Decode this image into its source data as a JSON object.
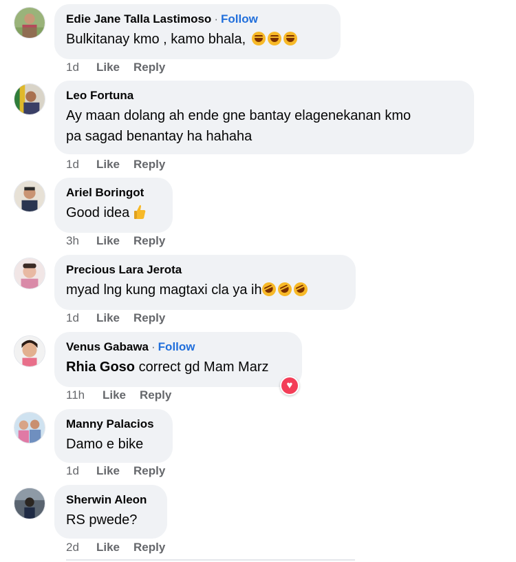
{
  "comments": [
    {
      "author": "Edie Jane Talla Lastimoso",
      "follow": "Follow",
      "text": "Bulkitanay kmo , kamo bhala,",
      "emoji": [
        "laugh",
        "laugh",
        "laugh"
      ],
      "time": "1d",
      "like": "Like",
      "reply": "Reply"
    },
    {
      "author": "Leo Fortuna",
      "text_lines": [
        "Ay maan dolang ah ende gne bantay elagenekanan kmo",
        "pa sagad benantay ha hahaha"
      ],
      "time": "1d",
      "like": "Like",
      "reply": "Reply"
    },
    {
      "author": "Ariel Boringot",
      "text": "Good idea",
      "emoji": [
        "thumbs-up"
      ],
      "time": "3h",
      "like": "Like",
      "reply": "Reply"
    },
    {
      "author": "Precious Lara Jerota",
      "text": "myad lng kung magtaxi cla ya ih",
      "emoji": [
        "rolling-laugh",
        "rolling-laugh",
        "rolling-laugh"
      ],
      "time": "1d",
      "like": "Like",
      "reply": "Reply"
    },
    {
      "author": "Venus Gabawa",
      "follow": "Follow",
      "mention": "Rhia Goso",
      "text": "correct gd Mam Marz",
      "reaction": "heart",
      "time": "11h",
      "like": "Like",
      "reply": "Reply"
    },
    {
      "author": "Manny Palacios",
      "text": "Damo e bike",
      "time": "1d",
      "like": "Like",
      "reply": "Reply"
    },
    {
      "author": "Sherwin Aleon",
      "text": "RS pwede?",
      "time": "2d",
      "like": "Like",
      "reply": "Reply"
    }
  ],
  "colors": {
    "bubble": "#f0f2f5",
    "meta_text": "#65676b",
    "follow_link": "#216fdb",
    "heart": "#f33e58",
    "emoji": "#f7b928"
  }
}
